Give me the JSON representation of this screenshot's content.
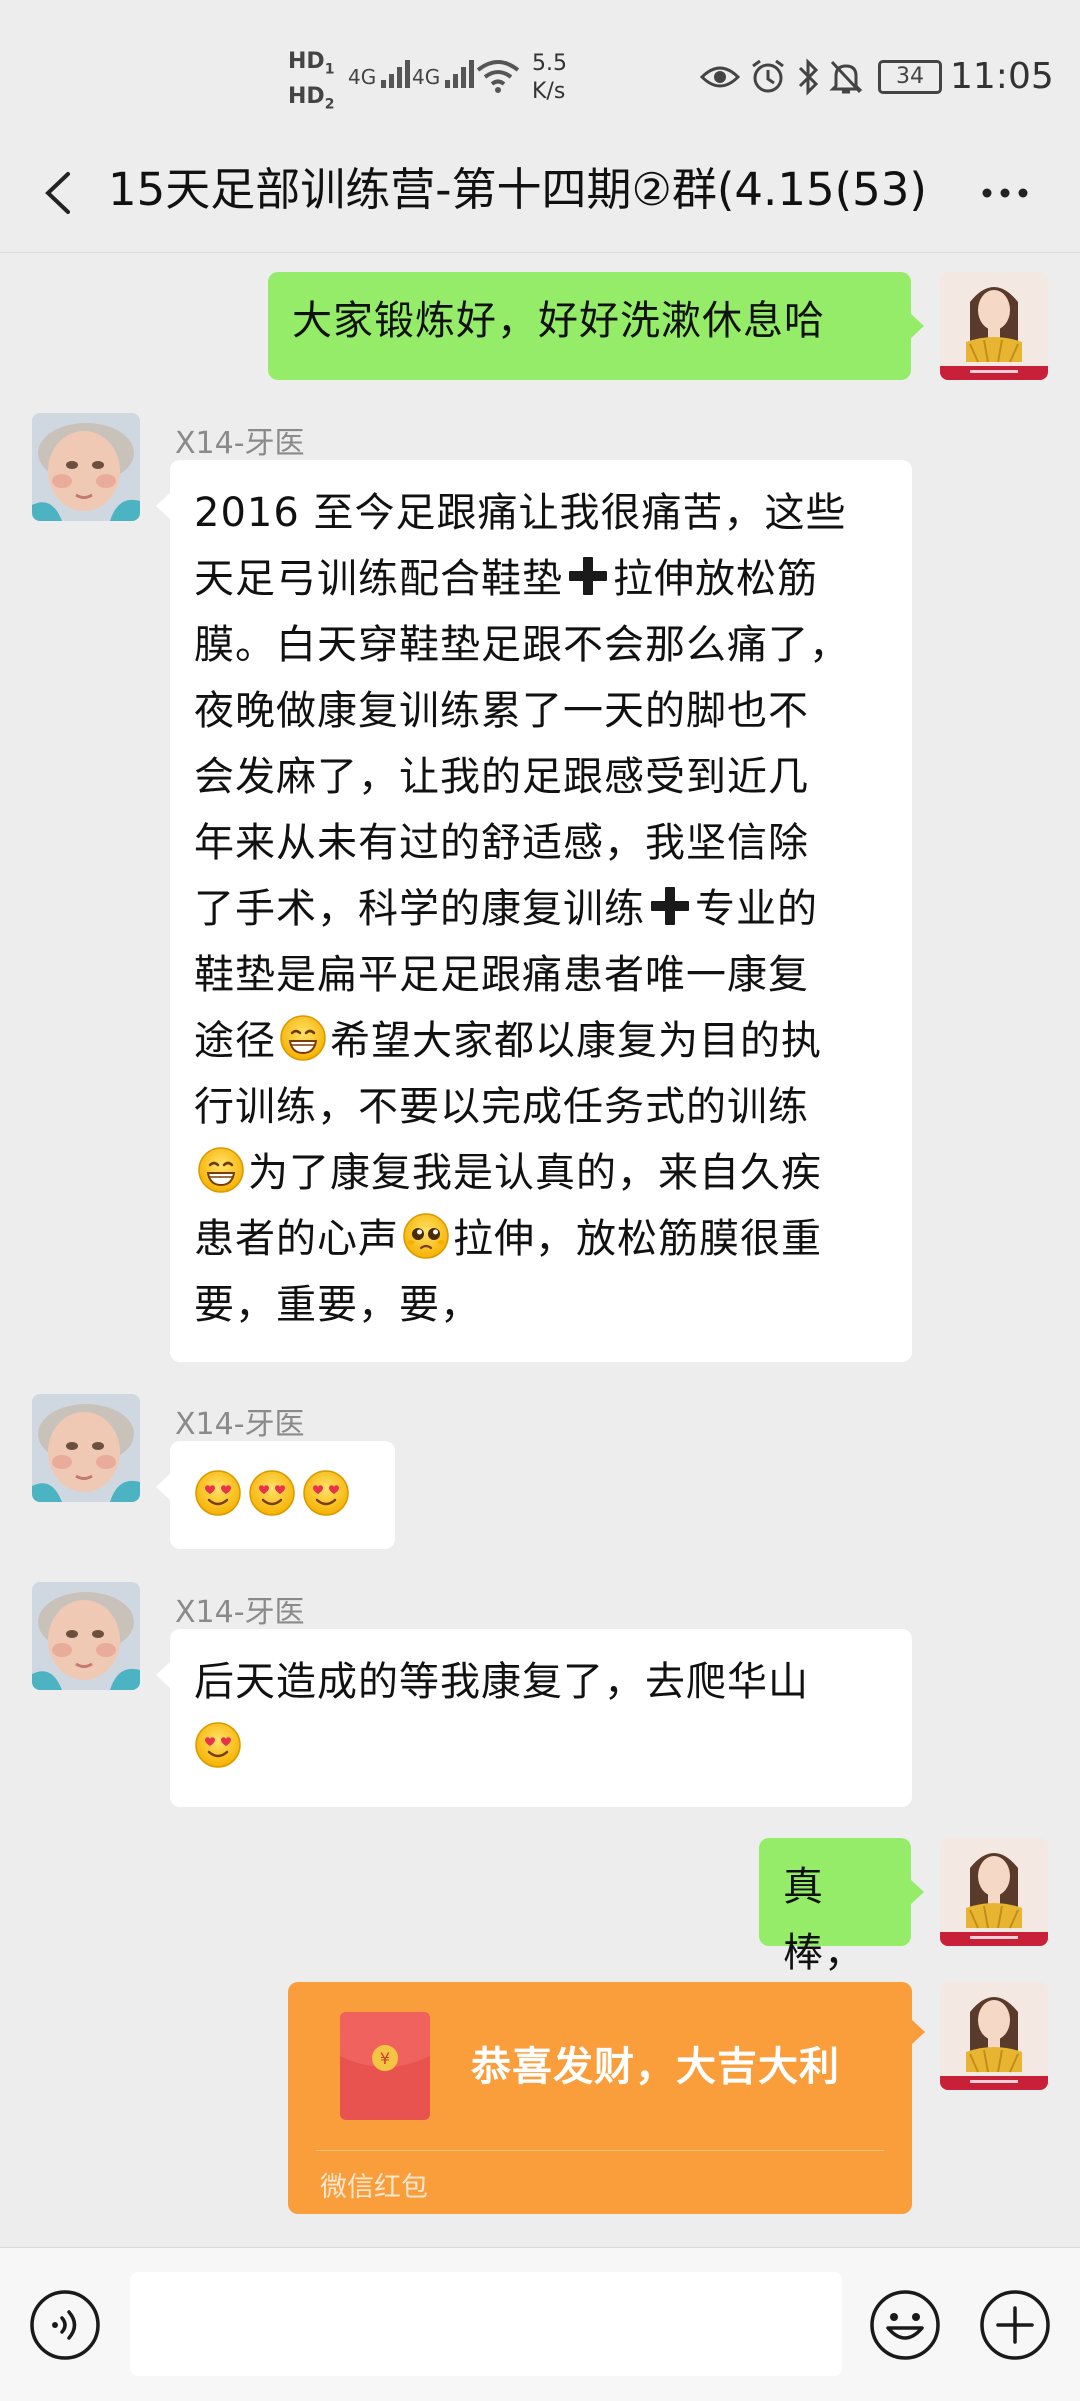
{
  "status_bar": {
    "sim1": "HD",
    "sim1_index": "1",
    "sim2": "HD",
    "sim2_index": "2",
    "net1": "4G",
    "net2": "4G",
    "speed_value": "5.5",
    "speed_unit": "K/s",
    "battery": "34",
    "time": "11:05"
  },
  "nav": {
    "title": "15天足部训练营-第十四期②群(4.15(53)"
  },
  "messages": [
    {
      "side": "right",
      "text": "大家锻炼好，好好洗漱休息哈"
    },
    {
      "side": "left",
      "sender": "X14-牙医",
      "parts": [
        "2016 至今足跟痛让我很痛苦，这些",
        "天足弓训练配合鞋垫",
        "拉伸放松筋",
        "膜。白天穿鞋垫足跟不会那么痛了，",
        "夜晚做康复训练累了一天的脚也不",
        "会发麻了，让我的足跟感受到近几",
        "年来从未有过的舒适感，我坚信除",
        "了手术，科学的康复训练",
        "专业的",
        "鞋垫是扁平足足跟痛患者唯一康复",
        "途径",
        "希望大家都以康复为目的执",
        "行训练，不要以完成任务式的训练",
        "为了康复我是认真的，来自久疾",
        "患者的心声",
        "拉伸，放松筋膜很重",
        "要，重要，要，"
      ]
    },
    {
      "side": "left",
      "sender": "X14-牙医",
      "emojis": [
        "heart-eyes",
        "heart-eyes",
        "heart-eyes"
      ]
    },
    {
      "side": "left",
      "sender": "X14-牙医",
      "text": "后天造成的等我康复了，去爬华山"
    },
    {
      "side": "right",
      "text": "真棒，"
    },
    {
      "side": "right",
      "type": "red_packet",
      "text": "恭喜发财，大吉大利",
      "label": "微信红包",
      "icon_char": "¥"
    }
  ],
  "colors": {
    "background": "#ededed",
    "bubble_self": "#95ec69",
    "bubble_other": "#ffffff",
    "red_packet": "#fa9d3b"
  },
  "icons": [
    "back-arrow-icon",
    "more-icon",
    "voice-icon",
    "emoji-icon",
    "plus-icon",
    "eye-icon",
    "alarm-icon",
    "bluetooth-icon",
    "mute-bell-icon",
    "wifi-icon"
  ]
}
